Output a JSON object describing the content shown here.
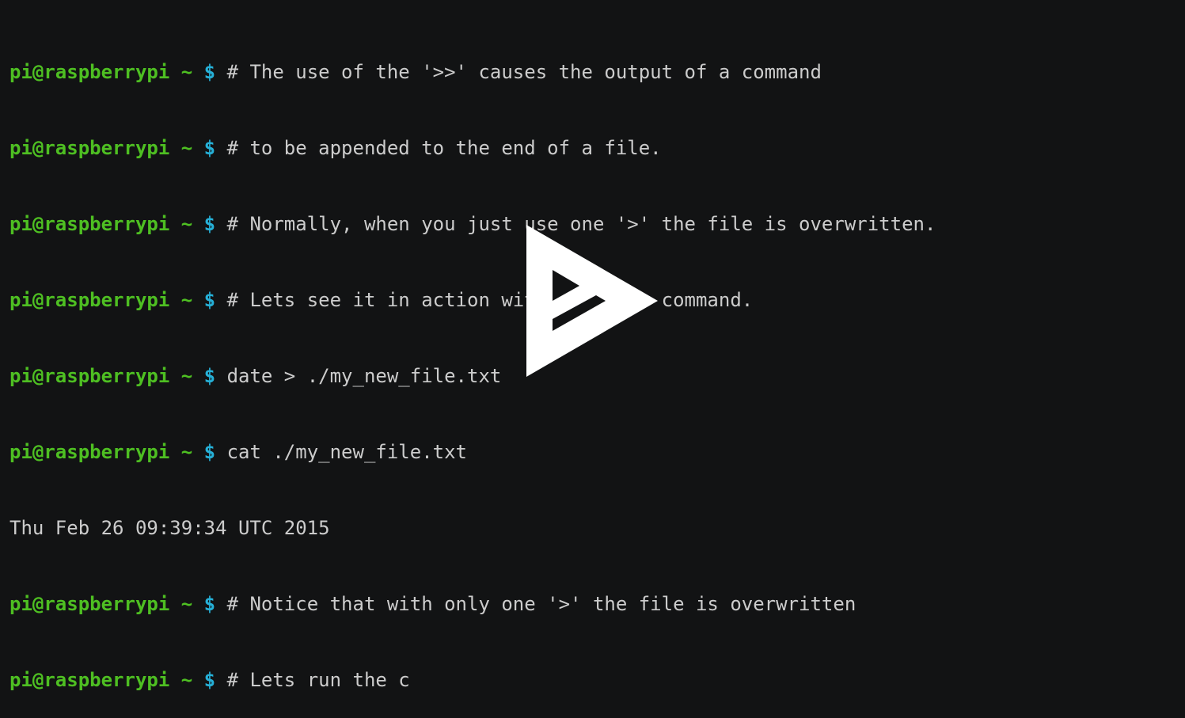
{
  "terminal": {
    "lines": [
      {
        "type": "prompt",
        "user": "pi@raspberrypi",
        "dir": "~",
        "sym": "$",
        "cmd": "# The use of the '>>' causes the output of a command"
      },
      {
        "type": "prompt",
        "user": "pi@raspberrypi",
        "dir": "~",
        "sym": "$",
        "cmd": "# to be appended to the end of a file."
      },
      {
        "type": "prompt",
        "user": "pi@raspberrypi",
        "dir": "~",
        "sym": "$",
        "cmd": "# Normally, when you just use one '>' the file is overwritten."
      },
      {
        "type": "prompt",
        "user": "pi@raspberrypi",
        "dir": "~",
        "sym": "$",
        "cmd": "# Lets see it in action with the date command."
      },
      {
        "type": "prompt",
        "user": "pi@raspberrypi",
        "dir": "~",
        "sym": "$",
        "cmd": "date > ./my_new_file.txt"
      },
      {
        "type": "prompt",
        "user": "pi@raspberrypi",
        "dir": "~",
        "sym": "$",
        "cmd": "cat ./my_new_file.txt"
      },
      {
        "type": "output",
        "text": "Thu Feb 26 09:39:34 UTC 2015"
      },
      {
        "type": "prompt",
        "user": "pi@raspberrypi",
        "dir": "~",
        "sym": "$",
        "cmd": "# Notice that with only one '>' the file is overwritten"
      },
      {
        "type": "prompt",
        "user": "pi@raspberrypi",
        "dir": "~",
        "sym": "$",
        "cmd": "# Lets run the c"
      }
    ]
  },
  "overlay": {
    "icon": "asciinema-play-icon"
  },
  "colors": {
    "background": "#121314",
    "user": "#4ebf22",
    "prompt_symbol": "#26b0d7",
    "text": "#cccccc",
    "play_icon": "#ffffff"
  }
}
